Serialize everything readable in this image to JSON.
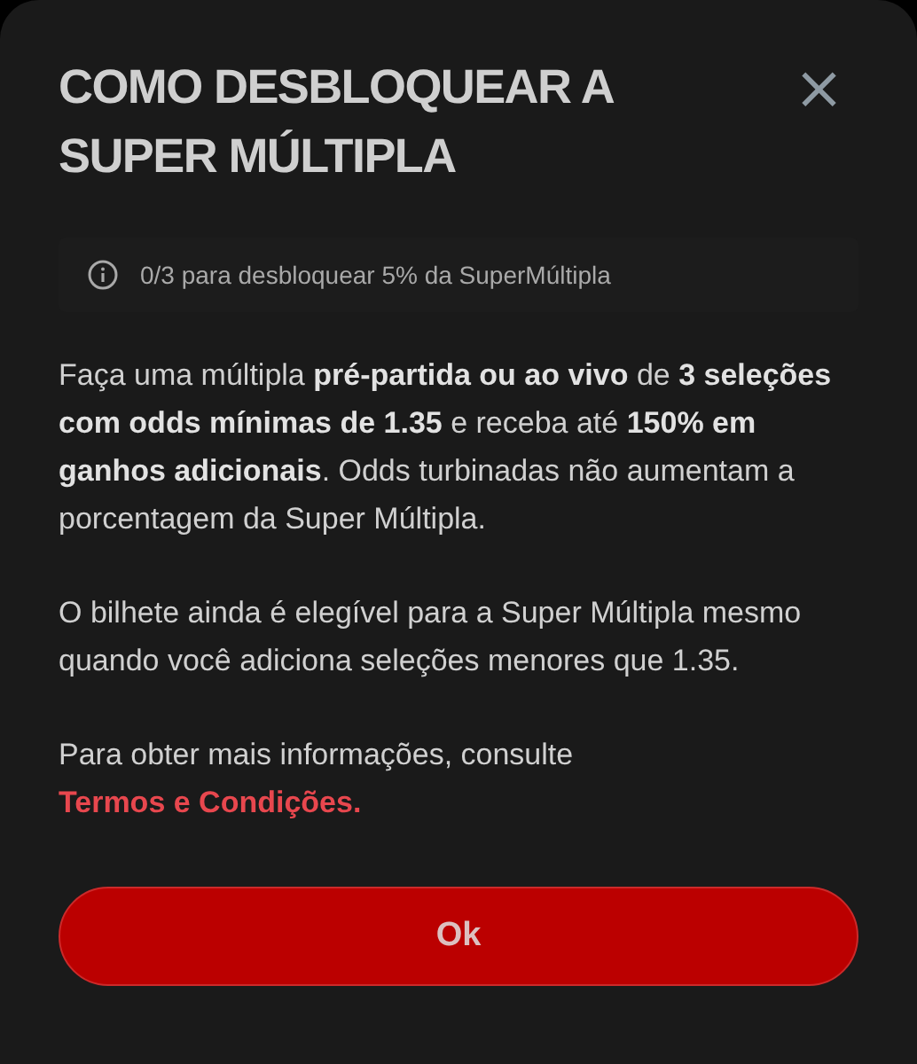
{
  "dialog": {
    "title": "COMO DESBLOQUEAR A SUPER MÚLTIPLA",
    "close": "×"
  },
  "progress_note": "0/3 para desbloquear 5% da SuperMúltipla",
  "paragraphs": [
    "Faça uma múltipla **pré-partida ou ao vivo** de **3 seleções com odds mínimas de 1.35** e receba até **150% em ganhos adicionais**. Odds turbinadas não aumentam a porcentagem da Super Múltipla.",
    "O bilhete ainda é elegível para a Super Múltipla mesmo quando você adiciona seleções menores que 1.35."
  ],
  "more_info": {
    "text": "Para obter mais informações, consulte",
    "link": "Termos e Condições."
  },
  "button": "Ok"
}
